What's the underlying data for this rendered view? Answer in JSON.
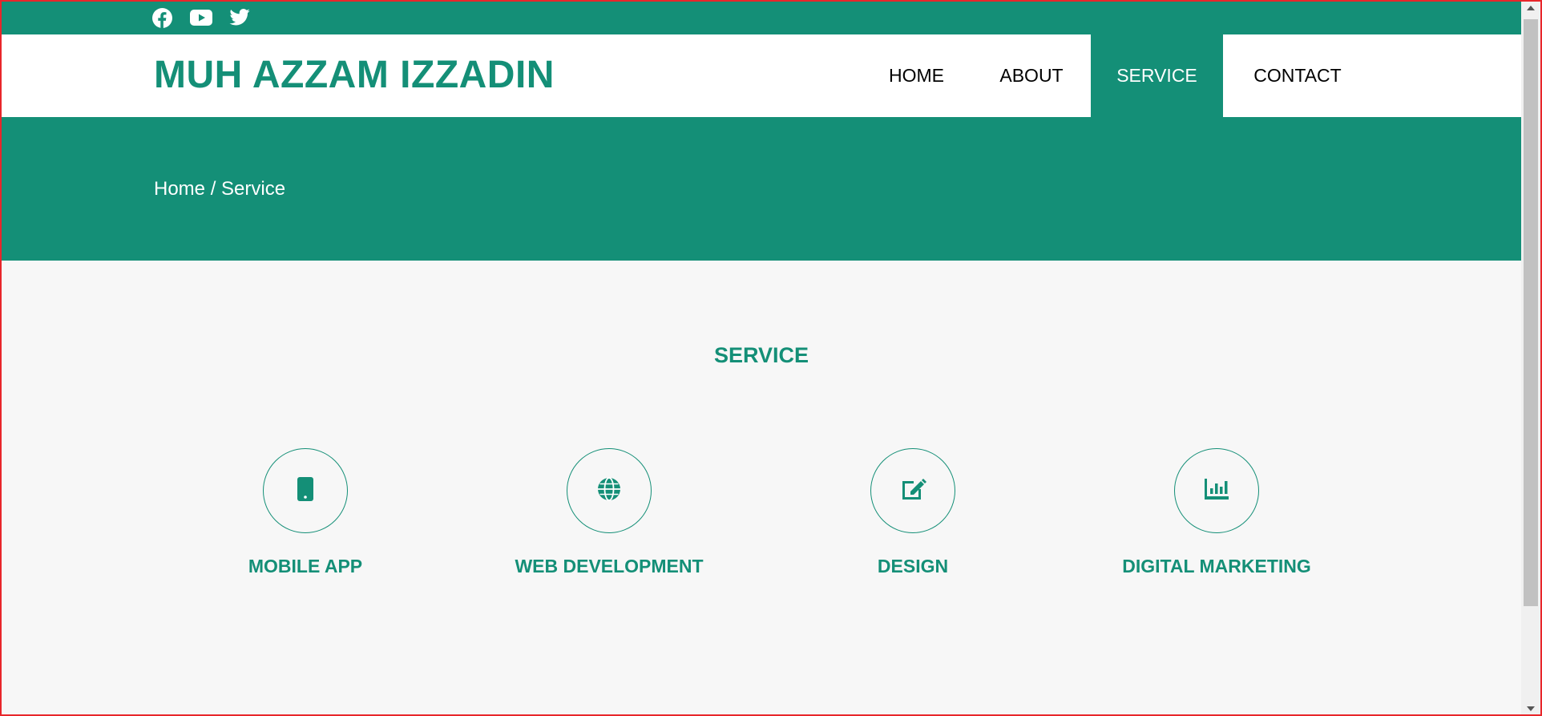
{
  "social": {
    "icons": [
      "facebook-icon",
      "youtube-icon",
      "twitter-icon"
    ]
  },
  "header": {
    "brand": "MUH AZZAM IZZADIN",
    "nav": [
      {
        "label": "HOME",
        "active": false
      },
      {
        "label": "ABOUT",
        "active": false
      },
      {
        "label": "SERVICE",
        "active": true
      },
      {
        "label": "CONTACT",
        "active": false
      }
    ]
  },
  "banner": {
    "breadcrumb": "Home / Service"
  },
  "main": {
    "title": "SERVICE",
    "services": [
      {
        "label": "MOBILE APP",
        "icon": "mobile-phone-icon"
      },
      {
        "label": "WEB DEVELOPMENT",
        "icon": "globe-icon"
      },
      {
        "label": "DESIGN",
        "icon": "edit-icon"
      },
      {
        "label": "DIGITAL MARKETING",
        "icon": "bar-chart-icon"
      }
    ]
  },
  "colors": {
    "primary": "#148f77",
    "background": "#f7f7f7",
    "white": "#ffffff"
  }
}
